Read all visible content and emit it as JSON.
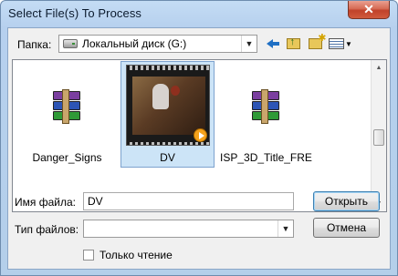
{
  "window": {
    "title": "Select File(s) To Process",
    "close_label": "✕"
  },
  "folder": {
    "label": "Папка:",
    "current": "Локальный диск (G:)"
  },
  "toolbar": {
    "back": "back-icon",
    "up": "up-folder-icon",
    "new_folder": "new-folder-icon",
    "view_menu": "view-menu-icon"
  },
  "files": [
    {
      "name": "Danger_Signs",
      "icon": "winrar-archive-icon",
      "selected": false
    },
    {
      "name": "DV",
      "icon": "video-thumbnail-icon",
      "selected": true
    },
    {
      "name": "ISP_3D_Title_FRE...",
      "icon": "winrar-archive-icon",
      "selected": false
    }
  ],
  "filename": {
    "label": "Имя файла:",
    "value": "DV"
  },
  "filetype": {
    "label": "Тип файлов:",
    "value": ""
  },
  "buttons": {
    "open": "Открыть",
    "cancel": "Отмена"
  },
  "readonly": {
    "label": "Только чтение",
    "checked": false
  },
  "colors": {
    "selection": "#cce4f7",
    "title_bar": "#b9d1ea",
    "close_button": "#c9462c"
  }
}
